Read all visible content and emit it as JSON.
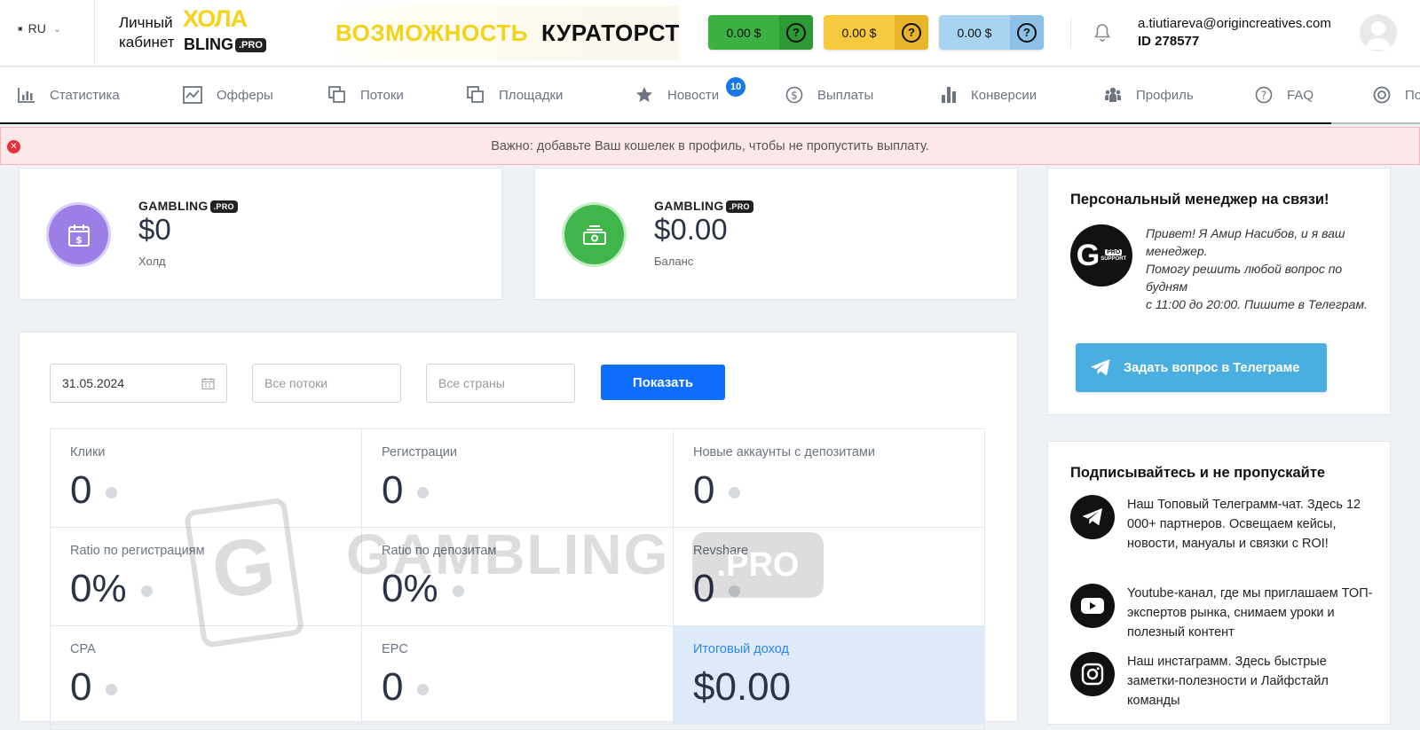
{
  "header": {
    "lang": "RU",
    "cabinet_label": "Личный кабинет",
    "logo_top": "ХОЛА",
    "logo_bottom": "BLING",
    "logo_pro": ".PRO",
    "banner_yellow": "ВОЗМОЖНОСТЬ",
    "banner_black": "КУРАТОРСТ",
    "wallets": [
      {
        "amount": "0.00 $",
        "color": "#3cb043"
      },
      {
        "amount": "0.00 $",
        "color": "#f7c93e"
      },
      {
        "amount": "0.00 $",
        "color": "#a9d4f1"
      }
    ],
    "user_email": "a.tiutiareva@origincreatives.com",
    "user_id": "ID 278577"
  },
  "nav": {
    "items": [
      {
        "label": "Статистика",
        "icon": "bar-chart-icon"
      },
      {
        "label": "Офферы",
        "icon": "line-chart-icon"
      },
      {
        "label": "Потоки",
        "icon": "copy-icon"
      },
      {
        "label": "Площадки",
        "icon": "copy-icon"
      },
      {
        "label": "Новости",
        "icon": "star-icon",
        "badge": "10"
      },
      {
        "label": "Выплаты",
        "icon": "dollar-icon"
      },
      {
        "label": "Конверсии",
        "icon": "bars-icon"
      },
      {
        "label": "Профиль",
        "icon": "users-icon"
      },
      {
        "label": "FAQ",
        "icon": "question-icon"
      },
      {
        "label": "По",
        "icon": "lifebuoy-icon"
      }
    ]
  },
  "alert": {
    "text": "Важно: добавьте Ваш кошелек в профиль, чтобы не пропустить выплату."
  },
  "stats": {
    "hold": {
      "brand": "GAMBLING",
      "pro": ".PRO",
      "value": "$0",
      "label": "Холд"
    },
    "balance": {
      "brand": "GAMBLING",
      "pro": ".PRO",
      "value": "$0.00",
      "label": "Баланс"
    }
  },
  "filter": {
    "date": "31.05.2024",
    "streams_placeholder": "Все потоки",
    "countries_placeholder": "Все страны",
    "show_label": "Показать"
  },
  "metrics": [
    {
      "label": "Клики",
      "value": "0"
    },
    {
      "label": "Регистрации",
      "value": "0"
    },
    {
      "label": "Новые аккаунты с депозитами",
      "value": "0"
    },
    {
      "label": "Ratio по регистрациям",
      "value": "0%"
    },
    {
      "label": "Ratio по депозитам",
      "value": "0%"
    },
    {
      "label": "Revshare",
      "value": "0"
    },
    {
      "label": "CPA",
      "value": "0"
    },
    {
      "label": "EPC",
      "value": "0"
    },
    {
      "label": "Итоговый доход",
      "value": "$0.00"
    }
  ],
  "watermark": {
    "brand": "GAMBLING",
    "pro": ".PRO"
  },
  "manager": {
    "title": "Персональный менеджер на связи!",
    "avatar_text": "G",
    "avatar_pro": "PRO",
    "avatar_support": "SUPPORT",
    "text": "Привет! Я Амир Насибов, и я ваш менеджер.\nПомогу решить любой вопрос по будням\nс 11:00 до 20:00. Пишите в Телеграм.",
    "button": "Задать вопрос в Телеграме"
  },
  "subscribe": {
    "title": "Подписывайтесь и не пропускайте",
    "items": [
      {
        "icon": "telegram-icon",
        "text": "Наш Топовый Телеграмм-чат. Здесь 12 000+ партнеров. Освещаем кейсы, новости, мануалы и связки с ROI!"
      },
      {
        "icon": "youtube-icon",
        "text": "Youtube-канал, где мы приглашаем ТОП-экспертов рынка, снимаем уроки и полезный контент"
      },
      {
        "icon": "instagram-icon",
        "text": "Наш инстаграмм. Здесь быстрые заметки-полезности и Лайфстайл команды"
      }
    ]
  }
}
